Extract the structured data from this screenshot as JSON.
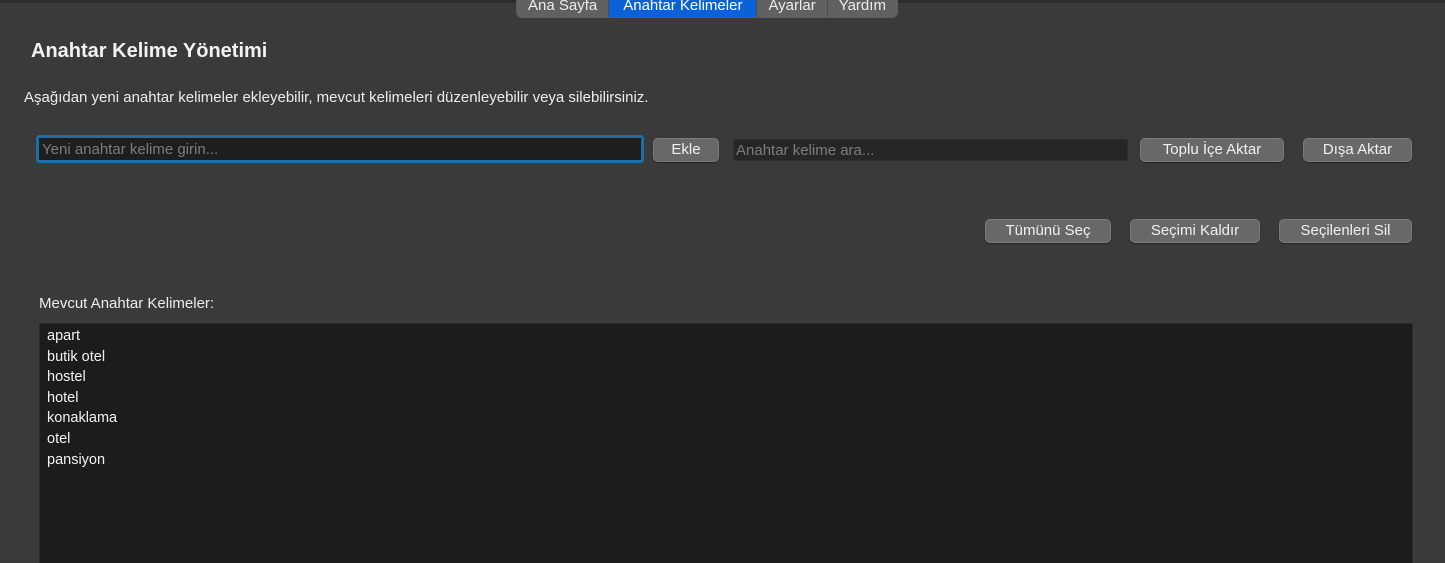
{
  "tabs": [
    {
      "label": "Ana Sayfa",
      "active": false
    },
    {
      "label": "Anahtar Kelimeler",
      "active": true
    },
    {
      "label": "Ayarlar",
      "active": false
    },
    {
      "label": "Yardım",
      "active": false
    }
  ],
  "page": {
    "title": "Anahtar Kelime Yönetimi",
    "description": "Aşağıdan yeni anahtar kelimeler ekleyebilir, mevcut kelimeleri düzenleyebilir veya silebilirsiniz."
  },
  "add": {
    "placeholder": "Yeni anahtar kelime girin...",
    "value": "",
    "button_label": "Ekle"
  },
  "search": {
    "placeholder": "Anahtar kelime ara...",
    "value": ""
  },
  "toolbar": {
    "import_label": "Toplu İçe Aktar",
    "export_label": "Dışa Aktar",
    "select_all_label": "Tümünü Seç",
    "deselect_label": "Seçimi Kaldır",
    "delete_selected_label": "Seçilenleri Sil"
  },
  "keywords": {
    "label": "Mevcut Anahtar Kelimeler:",
    "items": [
      "apart",
      "butik otel",
      "hostel",
      "hotel",
      "konaklama",
      "otel",
      "pansiyon"
    ]
  },
  "colors": {
    "accent": "#0a62d6",
    "focus_ring": "#1b6fa8",
    "background": "#3a3a3a",
    "list_background": "#1c1c1c"
  }
}
